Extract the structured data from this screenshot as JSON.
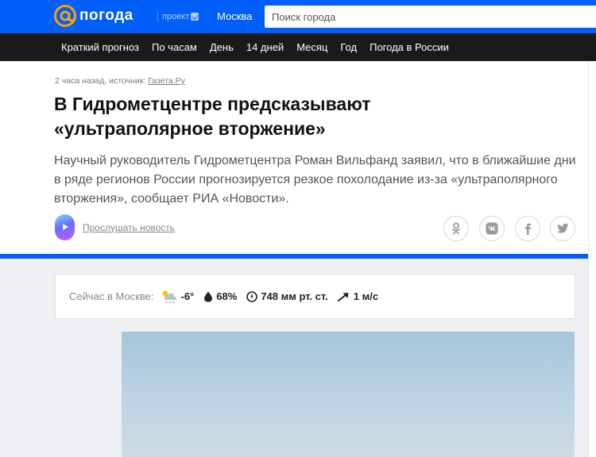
{
  "header": {
    "logo_text": "погода",
    "project_label": "проект",
    "city": "Москва",
    "search_placeholder": "Поиск города"
  },
  "nav": [
    {
      "label": "Краткий прогноз"
    },
    {
      "label": "По часам"
    },
    {
      "label": "День"
    },
    {
      "label": "14 дней"
    },
    {
      "label": "Месяц"
    },
    {
      "label": "Год"
    },
    {
      "label": "Погода в России"
    }
  ],
  "article": {
    "meta_prefix": "2 часа назад, источник:",
    "source": "Газета.Ру",
    "headline": "В Гидрометцентре предсказывают «ультраполярное вторжение»",
    "lead": "Научный руководитель Гидрометцентра Роман Вильфанд заявил, что в ближайшие дни в ряде регионов России прогнозируется резкое похолодание из-за «ультраполярного вторжения», сообщает РИА «Новости».",
    "listen_label": "Прослушать новость",
    "share": [
      {
        "name": "ok",
        "glyph": "ok-icon"
      },
      {
        "name": "vk",
        "glyph": "vk-icon"
      },
      {
        "name": "facebook",
        "glyph": "facebook-icon"
      },
      {
        "name": "twitter",
        "glyph": "twitter-icon"
      }
    ]
  },
  "weather": {
    "label": "Сейчас в Москве:",
    "temperature": "-6°",
    "humidity": "68%",
    "pressure": "748 мм рт. ст.",
    "wind": "1 м/с"
  },
  "colors": {
    "brand_blue": "#005ff9",
    "nav_bg": "#1a1a1a",
    "logo_orange": "#ff9e00"
  }
}
